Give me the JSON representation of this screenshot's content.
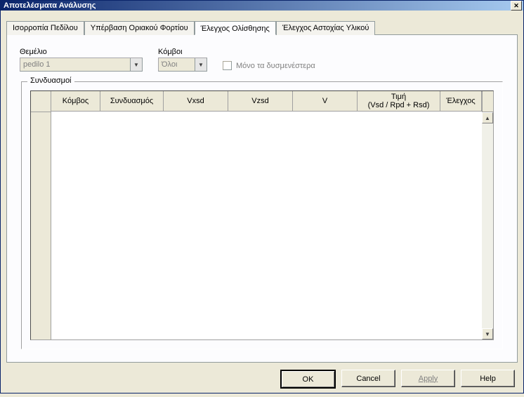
{
  "dialog_title": "Αποτελέσματα Ανάλυσης",
  "tabs": [
    {
      "label": "Ισορροπία Πεδίλου"
    },
    {
      "label": "Υπέρβαση Οριακού Φορτίου"
    },
    {
      "label": "Έλεγχος Ολίσθησης"
    },
    {
      "label": "Έλεγχος Αστοχίας Υλικού"
    }
  ],
  "foundation": {
    "label": "Θεμέλιο",
    "value": "pedilo 1"
  },
  "nodes": {
    "label": "Κόμβοι",
    "value": "Όλοι"
  },
  "only_worst": {
    "label": "Μόνο τα δυσμενέστερα"
  },
  "group_title": "Συνδυασμοί",
  "columns": [
    "Κόμβος",
    "Συνδυασμός",
    "Vxsd",
    "Vzsd",
    "V",
    "Τιμή\n(Vsd / Rpd + Rsd)",
    "Έλεγχος"
  ],
  "buttons": {
    "ok": "OK",
    "cancel": "Cancel",
    "apply": "Apply",
    "help": "Help"
  }
}
